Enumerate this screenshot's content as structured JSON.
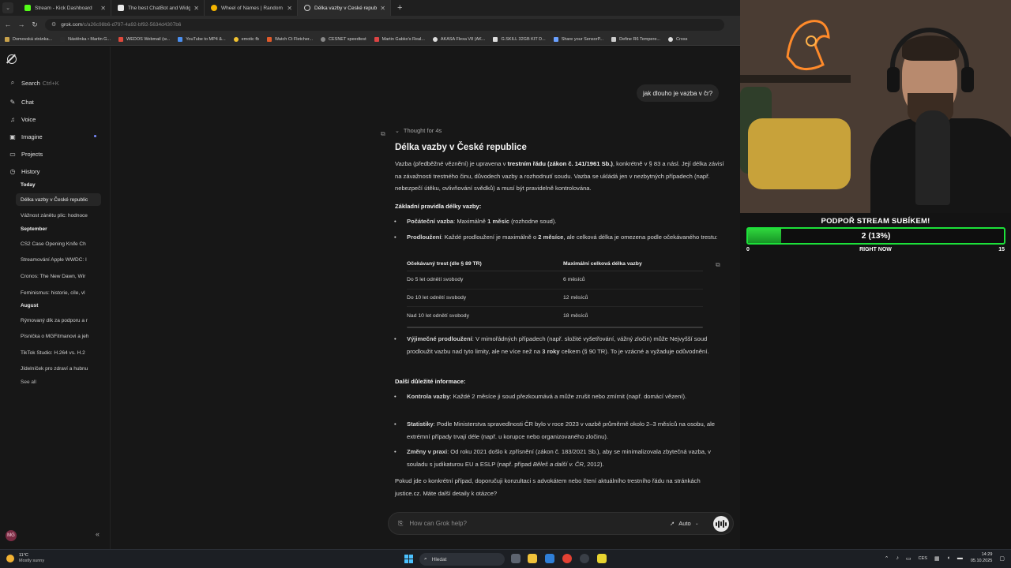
{
  "browser": {
    "tabs": [
      {
        "title": "Stream - Kick Dashboard",
        "color": "#53fc18",
        "active": false
      },
      {
        "title": "The best ChatBot and Widgets",
        "color": "#e8e8e8",
        "active": false
      },
      {
        "title": "Wheel of Names | Random nam",
        "color": "#f4b400",
        "active": false
      },
      {
        "title": "Délka vazby v České republice",
        "color": "#d0d0d0",
        "active": true
      }
    ],
    "url_host": "grok.com",
    "url_path": "/c/a26c98b6-d797-4a92-bf92-5634d4307b6",
    "bookmarks": [
      "Domovská stránka...",
      "Nástěnka • Martin G...",
      "WEDOS Webmail (w...",
      "YouTube to MP4 &...",
      "emotic fb",
      "Watch Ct Fletcher...",
      "CESNET speedtest",
      "Martin Gabko's Real...",
      "AKASA Flexa V8 (AK...",
      "G.SKILL 32GB KIT D...",
      "Share your SensorP...",
      "Define R6 Tempere...",
      "Cross"
    ]
  },
  "sidebar": {
    "search_label": "Search",
    "search_shortcut": "Ctrl+K",
    "nav": [
      {
        "label": "Chat",
        "icon": "chat-icon"
      },
      {
        "label": "Voice",
        "icon": "voice-icon"
      },
      {
        "label": "Imagine",
        "icon": "imagine-icon"
      },
      {
        "label": "Projects",
        "icon": "folder-icon"
      },
      {
        "label": "History",
        "icon": "history-icon"
      }
    ],
    "history": {
      "today_label": "Today",
      "today": [
        "Délka vazby v České republic",
        "Vážnost zánětu plic: hodnoce"
      ],
      "september_label": "September",
      "september": [
        "CS2 Case Opening Knife Ch",
        "Streamování Apple WWDC: I",
        "Cronos: The New Dawn, Wir",
        "Feminismus: historie, cíle, vl"
      ],
      "august_label": "August",
      "august": [
        "Rýmovaný dík za podporu a r",
        "Písnička o MGFitmanovi a jeh",
        "TikTok Studio: H.264 vs. H.2",
        "Jídelníček pro zdraví a hubnu"
      ],
      "see_all": "See all"
    },
    "avatar_initials": "MG"
  },
  "chat": {
    "user_message": "jak dlouho je vazba v čr?",
    "thought_label": "Thought for 4s",
    "title": "Délka vazby v České republice",
    "intro": {
      "p1": "Vazba (předběžné věznění) je upravena v ",
      "b1": "trestním řádu (zákon č. 141/1961 Sb.)",
      "p2": ", konkrétně v § 83 a násl. Její délka závisí na závažnosti trestného činu, důvodech vazby a rozhodnutí soudu. Vazba se ukládá jen v nezbytných případech (např. nebezpečí útěku, ovlivňování svědků) a musí být pravidelně kontrolována."
    },
    "rules_heading": "Základní pravidla délky vazby:",
    "rule1": {
      "label": "Počáteční vazba",
      "t1": ": Maximálně ",
      "b": "1 měsíc",
      "t2": " (rozhodne soud)."
    },
    "rule2": {
      "label": "Prodloužení",
      "t1": ": Každé prodloužení je maximálně o ",
      "b": "2 měsíce",
      "t2": ", ale celková délka je omezena podle očekávaného trestu:"
    },
    "table": {
      "headers": [
        "Očekávaný trest (dle § 89 TR)",
        "Maximální celková délka vazby"
      ],
      "rows": [
        [
          "Do 5 let odnětí svobody",
          "6 měsíců"
        ],
        [
          "Do 10 let odnětí svobody",
          "12 měsíců"
        ],
        [
          "Nad 10 let odnětí svobody",
          "18 měsíců"
        ]
      ]
    },
    "rule3": {
      "label": "Výjimečné prodloužení",
      "t1": ": V mimořádných případech (např. složité vyšetřování, vážný zločin) může Nejvyšší soud prodloužit vazbu nad tyto limity, ale ne více než na ",
      "b": "3 roky",
      "t2": " celkem (§ 90 TR). To je vzácné a vyžaduje odůvodnění."
    },
    "info_heading": "Další důležité informace:",
    "info1": {
      "label": "Kontrola vazby",
      "t": ": Každé 2 měsíce ji soud přezkoumává a může zrušit nebo zmírnit (např. domácí vězení)."
    },
    "info2": {
      "label": "Statistiky",
      "t": ": Podle Ministerstva spravedlnosti ČR bylo v roce 2023 v vazbě průměrně okolo 2–3 měsíců na osobu, ale extrémní případy trvají déle (např. u korupce nebo organizovaného zločinu)."
    },
    "info3": {
      "label": "Změny v praxi",
      "t1": ": Od roku 2021 došlo k zpřísnění (zákon č. 183/2021 Sb.), aby se minimalizovala zbytečná vazba, v souladu s judikaturou EU a ESLP (např. případ ",
      "i": "Běleš a další v. ČR",
      "t2": ", 2012)."
    },
    "closing": "Pokud jde o konkrétní případ, doporučuji konzultaci s advokátem nebo čtení aktuálního trestního řádu na stránkách justice.cz. Máte další detaily k otázce?",
    "input_placeholder": "How can Grok help?",
    "mode_label": "Auto"
  },
  "overlay": {
    "title": "PODPOŘ STREAM SUBÍKEM!",
    "value_label": "2 (13%)",
    "progress": 0.13,
    "min_label": "0",
    "mid_label": "RIGHT NOW",
    "max_label": "15",
    "bar_color": "#1ce13a"
  },
  "taskbar": {
    "temp": "11°C",
    "weather": "Mostly sunny",
    "search": "Hledat",
    "lang": "CES",
    "time": "14:29",
    "date": "05.10.2025"
  }
}
